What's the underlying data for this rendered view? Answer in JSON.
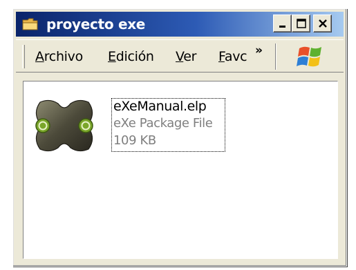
{
  "window": {
    "title": "proyecto exe",
    "title_icon": "folder-icon",
    "caption_buttons": [
      "minimize-icon",
      "maximize-icon",
      "close-icon"
    ]
  },
  "menubar": {
    "items": [
      {
        "label": "Archivo",
        "accel": "A"
      },
      {
        "label": "Edición",
        "accel": "E"
      },
      {
        "label": "Ver",
        "accel": "V"
      },
      {
        "label": "Favc",
        "accel": "F"
      }
    ],
    "overflow_label": "»",
    "logo": "windows-logo-icon"
  },
  "files": [
    {
      "name": "eXeManual.elp",
      "type": "eXe Package File",
      "size": "109 KB",
      "icon": "exe-package-icon"
    }
  ],
  "colors": {
    "title_gradient_start": "#0a246a",
    "title_gradient_end": "#a6caf0",
    "window_face": "#ece9d8",
    "content_bg": "#ffffff",
    "secondary_text": "#7f7f7f"
  }
}
